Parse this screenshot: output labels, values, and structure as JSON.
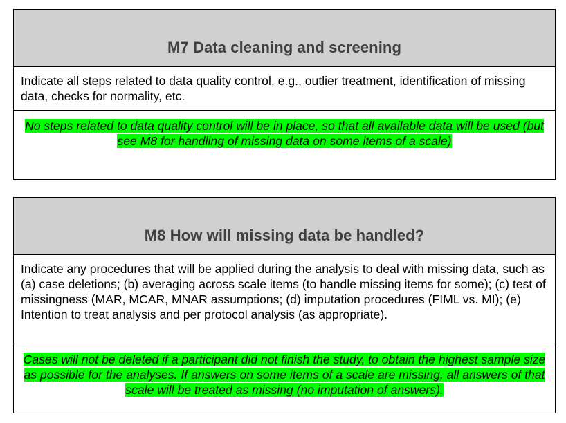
{
  "sections": [
    {
      "title": "M7 Data cleaning and screening",
      "prompt": "Indicate all steps related to data quality control, e.g., outlier treatment, identification of missing data, checks for normality, etc.",
      "answer": "No steps related to data quality control will be in place, so that all available data will be used (but see M8 for handling of missing data on some items of a scale)",
      "highlight_color": "#00ff00"
    },
    {
      "title": "M8 How will missing data be handled?",
      "prompt": "Indicate any procedures that will be applied during the analysis to deal with missing data, such as (a) case deletions; (b) averaging across scale items (to handle missing items for some); (c) test of missingness (MAR, MCAR, MNAR assumptions; (d) imputation procedures (FIML vs. MI); (e) Intention to treat analysis and per protocol analysis (as appropriate).",
      "answer": "Cases will not be deleted if a participant did not finish the study, to obtain the highest sample size as possible for the analyses. If answers on some items of a scale are missing, all answers of that scale will be treated as missing (no imputation of answers).",
      "highlight_color": "#00ff00"
    }
  ],
  "header_background": "#d0d0d0",
  "title_color": "#404040"
}
